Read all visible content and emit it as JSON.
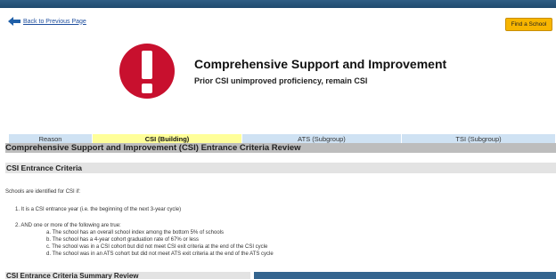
{
  "nav": {
    "back_label": "Back to Previous Page",
    "find_school_label": "Find a School"
  },
  "alert": {
    "title": "Comprehensive Support and Improvement",
    "subtitle": "Prior CSI unimproved proficiency, remain CSI",
    "icon": "exclamation-circle-icon",
    "icon_color": "#c8102e"
  },
  "tabs": [
    {
      "label": "Reason",
      "active": false
    },
    {
      "label": "CSI (Building)",
      "active": true
    },
    {
      "label": "ATS (Subgroup)",
      "active": false
    },
    {
      "label": "TSI (Subgroup)",
      "active": false
    }
  ],
  "review": {
    "section_title": "Comprehensive Support and Improvement (CSI) Entrance Criteria Review",
    "criteria_title": "CSI Entrance Criteria",
    "intro": "Schools are identified for CSI if:",
    "item1": "1. It is a CSI entrance year (i.e. the beginning of the next 3-year cycle)",
    "item2": "2. AND one or more of the following are true:",
    "subitems": [
      "a. The school has an overall school index among the bottom 5% of schools",
      "b. The school has a 4-year cohort graduation rate of 67% or less",
      "c. The school was in a CSI cohort but did not meet CSI exit criteria at the end of the CSI cycle",
      "d. The school was in an ATS cohort but did not meet ATS exit criteria at the end of the ATS cycle"
    ],
    "summary_title": "CSI Entrance Criteria Summary Review"
  },
  "colors": {
    "tab_inactive": "#cfe2f3",
    "tab_active": "#ffff99",
    "button": "#f7b500",
    "header_bar": "#1f4a6e"
  }
}
